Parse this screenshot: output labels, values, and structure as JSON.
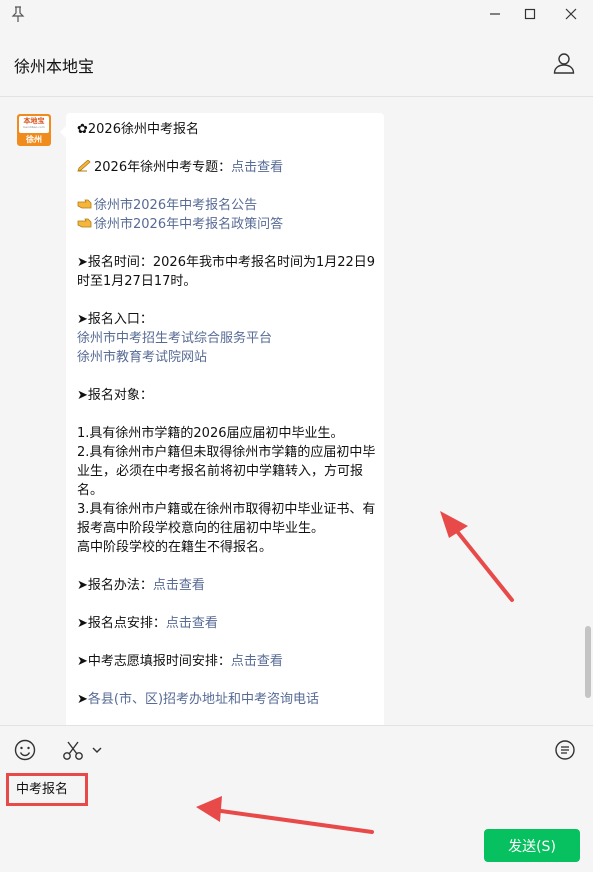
{
  "window": {
    "title": "徐州本地宝"
  },
  "contact": {
    "avatar": {
      "brand": "本地宝",
      "sub": "bendibao.com",
      "city": "徐州"
    }
  },
  "message": {
    "lines": [
      {
        "prefix": "✿2026徐州中考报名",
        "link": ""
      },
      {
        "prefix": "",
        "link": ""
      },
      {
        "icon": "writing-hand-icon",
        "prefix": "2026年徐州中考专题：",
        "link": "点击查看"
      },
      {
        "prefix": "",
        "link": ""
      },
      {
        "icon": "pointing-hand-icon",
        "prefix": "",
        "link": "徐州市2026年中考报名公告"
      },
      {
        "icon": "pointing-hand-icon",
        "prefix": "",
        "link": "徐州市2026年中考报名政策问答"
      },
      {
        "prefix": "",
        "link": ""
      },
      {
        "prefix": "➤报名时间：2026年我市中考报名时间为1月22日9时至1月27日17时。",
        "link": ""
      },
      {
        "prefix": "",
        "link": ""
      },
      {
        "prefix": "➤报名入口：",
        "link": ""
      },
      {
        "prefix": "",
        "link": "徐州市中考招生考试综合服务平台"
      },
      {
        "prefix": "",
        "link": "徐州市教育考试院网站"
      },
      {
        "prefix": "",
        "link": ""
      },
      {
        "prefix": "➤报名对象：",
        "link": ""
      },
      {
        "prefix": "",
        "link": ""
      },
      {
        "prefix": "1.具有徐州市学籍的2026届应届初中毕业生。",
        "link": ""
      },
      {
        "prefix": "2.具有徐州市户籍但未取得徐州市学籍的应届初中毕业生，必须在中考报名前将初中学籍转入，方可报名。",
        "link": ""
      },
      {
        "prefix": "3.具有徐州市户籍或在徐州市取得初中毕业证书、有报考高中阶段学校意向的往届初中毕业生。",
        "link": ""
      },
      {
        "prefix": "高中阶段学校的在籍生不得报名。",
        "link": ""
      },
      {
        "prefix": "",
        "link": ""
      },
      {
        "prefix": "➤报名办法：",
        "link": "点击查看"
      },
      {
        "prefix": "",
        "link": ""
      },
      {
        "prefix": "➤报名点安排：",
        "link": "点击查看"
      },
      {
        "prefix": "",
        "link": ""
      },
      {
        "prefix": "➤中考志愿填报时间安排：",
        "link": "点击查看"
      },
      {
        "prefix": "",
        "link": ""
      },
      {
        "prefix": "➤",
        "link": "各县(市、区)招考办地址和中考咨询电话"
      }
    ]
  },
  "input": {
    "value": "中考报名"
  },
  "send_button": {
    "label": "发送(S)"
  },
  "colors": {
    "accent": "#07c160",
    "link": "#576b95",
    "annotation": "#e84a4a"
  }
}
